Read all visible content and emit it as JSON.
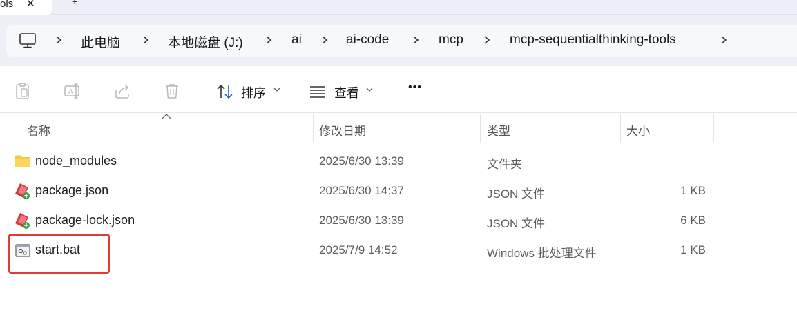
{
  "tabs": {
    "title": "ols",
    "close_glyph": "✕",
    "new_glyph": "+"
  },
  "breadcrumb": {
    "items": [
      "此电脑",
      "本地磁盘 (J:)",
      "ai",
      "ai-code",
      "mcp",
      "mcp-sequentialthinking-tools"
    ]
  },
  "toolbar": {
    "sort_label": "排序",
    "view_label": "查看",
    "more_label": "•••"
  },
  "columns": {
    "name": "名称",
    "date": "修改日期",
    "type": "类型",
    "size": "大小"
  },
  "files": [
    {
      "name": "node_modules",
      "date": "2025/6/30 13:39",
      "type": "文件夹",
      "size": "",
      "icon": "folder-icon"
    },
    {
      "name": "package.json",
      "date": "2025/6/30 14:37",
      "type": "JSON 文件",
      "size": "1 KB",
      "icon": "json-file-icon"
    },
    {
      "name": "package-lock.json",
      "date": "2025/6/30 13:39",
      "type": "JSON 文件",
      "size": "6 KB",
      "icon": "json-file-icon"
    },
    {
      "name": "start.bat",
      "date": "2025/7/9 14:52",
      "type": "Windows 批处理文件",
      "size": "1 KB",
      "icon": "batch-file-icon"
    }
  ],
  "colors": {
    "highlight": "#e53935",
    "folder": "#f8c642",
    "chrome_bg": "#eef0f7"
  }
}
